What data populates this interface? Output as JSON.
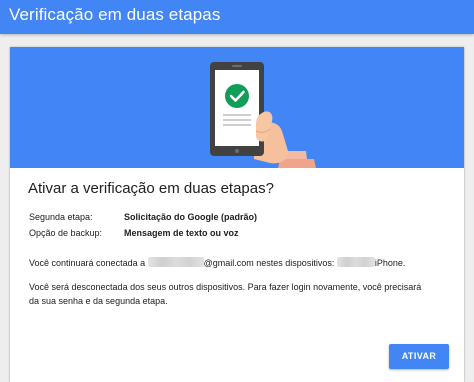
{
  "header": {
    "title": "Verificação em duas etapas"
  },
  "dialog": {
    "heading": "Ativar a verificação em duas etapas?",
    "rows": [
      {
        "label": "Segunda etapa:",
        "value": "Solicitação do Google (padrão)"
      },
      {
        "label": "Opção de backup:",
        "value": "Mensagem de texto ou voz"
      }
    ],
    "signed_in": {
      "prefix": "Você continuará conectada a",
      "email_suffix": "@gmail.com",
      "middle": "nestes dispositivos:",
      "device": "iPhone",
      "end": "."
    },
    "signout_line1": "Você será desconectada dos seus outros dispositivos. Para fazer login novamente, você precisará",
    "signout_line2": "da sua senha e da segunda etapa.",
    "activate_button": "ATIVAR"
  },
  "illustration": {
    "icon": "phone-with-checkmark-icon",
    "banner_color": "#4285f4",
    "check_color": "#0f9d58"
  },
  "colors": {
    "accent": "#4285f4"
  }
}
